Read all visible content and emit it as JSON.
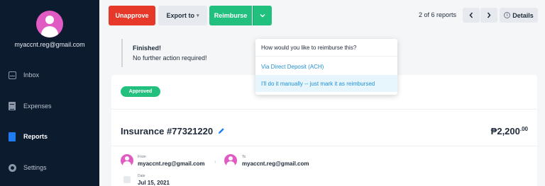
{
  "sidebar": {
    "user_email": "myaccnt.reg@gmail.com",
    "items": [
      {
        "label": "Inbox",
        "icon": "inbox-icon"
      },
      {
        "label": "Expenses",
        "icon": "expenses-icon"
      },
      {
        "label": "Reports",
        "icon": "reports-icon",
        "active": true
      },
      {
        "label": "Settings",
        "icon": "settings-icon"
      }
    ]
  },
  "toolbar": {
    "unapprove_label": "Unapprove",
    "export_label": "Export to",
    "reimburse_label": "Reimburse",
    "report_position": "2",
    "report_total": "6",
    "report_position_text": "2 of 6 reports",
    "prev_label": "‹",
    "next_label": "›",
    "details_label": "Details"
  },
  "notice": {
    "title": "Finished!",
    "body": "No further action required!"
  },
  "reimburse_menu": {
    "header": "How would you like to reimburse this?",
    "options": [
      "Via Direct Deposit (ACH)",
      "I'll do it manually -- just mark it as reimbursed"
    ]
  },
  "report": {
    "status": "Approved",
    "title": "Insurance #77321220",
    "amount_main": "₱2,200",
    "amount_cents": ".00",
    "from_label": "From",
    "from_email": "myaccnt.reg@gmail.com",
    "to_label": "To",
    "to_email": "myaccnt.reg@gmail.com",
    "date_label": "Date",
    "date_value": "Jul 15, 2021"
  },
  "colors": {
    "sidebar_bg": "#0d1b2e",
    "danger": "#e6392a",
    "success": "#21c07e",
    "link": "#1f8fd1",
    "avatar": "#e05cc3"
  }
}
